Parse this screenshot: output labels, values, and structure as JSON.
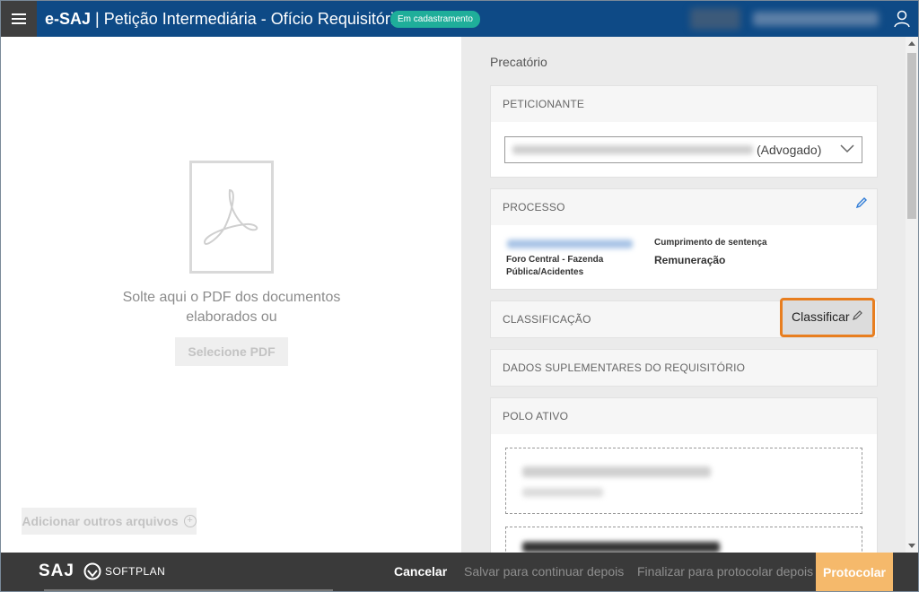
{
  "header": {
    "brand": "e-SAJ",
    "separator": " | ",
    "title": "Petição Intermediária - Ofício Requisitório",
    "status_badge": "Em cadastramento"
  },
  "dropzone": {
    "drop_text": "Solte aqui o PDF dos documentos elaborados ou",
    "select_pdf_label": "Selecione PDF",
    "add_files_label": "Adicionar outros arquivos"
  },
  "form": {
    "section_title": "Precatório",
    "peticionante": {
      "label": "PETICIONANTE",
      "selected_role": "(Advogado)"
    },
    "processo": {
      "label": "PROCESSO",
      "foro": "Foro Central - Fazenda Pública/Acidentes",
      "classe": "Cumprimento de sentença",
      "assunto": "Remuneração"
    },
    "classificacao": {
      "label": "CLASSIFICAÇÃO",
      "button_label": "Classificar"
    },
    "dados_suplementares": {
      "label": "DADOS SUPLEMENTARES DO REQUISITÓRIO"
    },
    "polo_ativo": {
      "label": "POLO ATIVO"
    }
  },
  "footer": {
    "logo_text": "SAJ",
    "softplan_text": "SOFTPLAN",
    "cancel_label": "Cancelar",
    "save_later_label": "Salvar para continuar depois",
    "finalize_label": "Finalizar para protocolar depois",
    "protocol_label": "Protocolar"
  },
  "icons": {
    "menu": "hamburger-menu-icon",
    "user": "user-icon",
    "pdf": "pdf-document-icon",
    "edit": "pencil-icon",
    "chevron": "chevron-down-icon",
    "add": "plus-circle-icon"
  },
  "colors": {
    "header_bg": "#0e4a86",
    "badge_bg": "#1fae9a",
    "highlight_border": "#e87e1f",
    "protocol_bg": "#f5b96b",
    "footer_bg": "#3a3a3a"
  }
}
